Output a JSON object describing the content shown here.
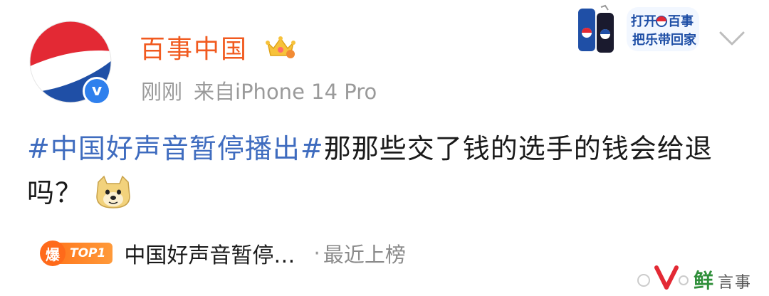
{
  "post": {
    "author": "百事中国",
    "time": "刚刚",
    "source": "来自iPhone 14 Pro",
    "hashtag": "#中国好声音暂停播出#",
    "text": "那那些交了钱的选手的钱会给退吗？"
  },
  "promo": {
    "line1": "打开",
    "line1b": "百事",
    "line2": "把乐带回家"
  },
  "hot": {
    "badge": "爆",
    "rank": "TOP1",
    "topic": "中国好声音暂停…",
    "separator": "·",
    "tag": "最近上榜"
  },
  "watermark": {
    "text": "鲜"
  },
  "colors": {
    "name": "#f15a1f",
    "hashtag": "#3f6cbf",
    "meta": "#9a9a9a",
    "pepsi_red": "#e32934",
    "pepsi_blue": "#1f4fa6"
  }
}
